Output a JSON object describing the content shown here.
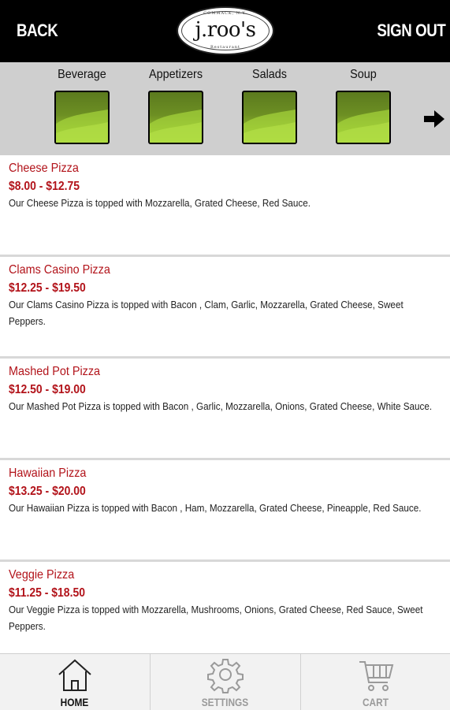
{
  "header": {
    "back_label": "BACK",
    "sign_out_label": "SIGN OUT",
    "logo": {
      "name": "j.roo's",
      "top_text": "COMMACK, N.Y.",
      "bottom_text": "Restaurant"
    }
  },
  "categories": [
    {
      "label": "Beverage",
      "icon": "image-thumbnail"
    },
    {
      "label": "Appetizers",
      "icon": "image-thumbnail"
    },
    {
      "label": "Salads",
      "icon": "image-thumbnail"
    },
    {
      "label": "Soup",
      "icon": "image-thumbnail"
    }
  ],
  "next_arrow_icon": "arrow-right-icon",
  "items": [
    {
      "title": "Cheese Pizza",
      "price": "$8.00 - $12.75",
      "description": "Our Cheese Pizza is topped with Mozzarella, Grated Cheese, Red Sauce."
    },
    {
      "title": "Clams Casino Pizza",
      "price": "$12.25 - $19.50",
      "description": "Our Clams Casino Pizza is topped with Bacon , Clam, Garlic, Mozzarella, Grated Cheese, Sweet Peppers."
    },
    {
      "title": "Mashed Pot Pizza",
      "price": "$12.50 - $19.00",
      "description": "Our Mashed Pot Pizza is topped with Bacon , Garlic, Mozzarella, Onions, Grated Cheese, White Sauce."
    },
    {
      "title": "Hawaiian Pizza",
      "price": "$13.25 - $20.00",
      "description": "Our Hawaiian Pizza is topped with Bacon , Ham, Mozzarella, Grated Cheese, Pineapple, Red Sauce."
    },
    {
      "title": "Veggie Pizza",
      "price": "$11.25 - $18.50",
      "description": "Our Veggie Pizza is topped with Mozzarella, Mushrooms, Onions, Grated Cheese, Red Sauce, Sweet Peppers."
    }
  ],
  "tabs": [
    {
      "label": "HOME",
      "icon": "home-icon",
      "active": true
    },
    {
      "label": "SETTINGS",
      "icon": "gear-icon",
      "active": false
    },
    {
      "label": "CART",
      "icon": "cart-icon",
      "active": false
    }
  ],
  "colors": {
    "header_bg": "#000000",
    "category_bar_bg": "#cfcfcf",
    "item_title": "#b2131a",
    "thumbnail_green": "#88b12b"
  }
}
